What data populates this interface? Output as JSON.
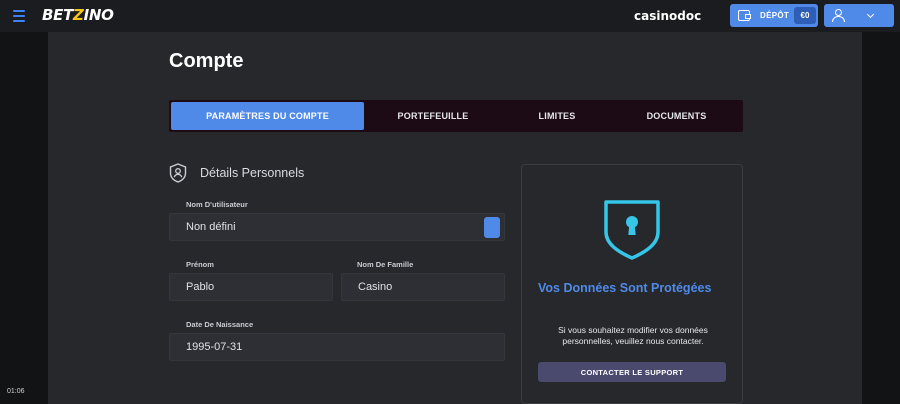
{
  "header": {
    "logo_main": "BET",
    "logo_z": "Z",
    "logo_end": "INO",
    "partner": "casinodoc",
    "deposit_label": "DÉPÔT",
    "balance": "€0"
  },
  "clock": "01:06",
  "page": {
    "title": "Compte"
  },
  "tabs": [
    {
      "label": "PARAMÈTRES DU COMPTE",
      "active": true
    },
    {
      "label": "PORTEFEUILLE",
      "active": false
    },
    {
      "label": "LIMITES",
      "active": false
    },
    {
      "label": "DOCUMENTS",
      "active": false
    }
  ],
  "personal": {
    "section_title": "Détails Personnels",
    "username": {
      "label": "Nom D'utilisateur",
      "value": "Non défini"
    },
    "first_name": {
      "label": "Prénom",
      "value": "Pablo"
    },
    "last_name": {
      "label": "Nom De Famille",
      "value": "Casino"
    },
    "birth_date": {
      "label": "Date De Naissance",
      "value": "1995-07-31"
    }
  },
  "protection": {
    "title": "Vos Données Sont Protégées",
    "text": "Si vous souhaitez modifier vos données personnelles, veuillez nous contacter.",
    "button": "CONTACTER LE SUPPORT"
  },
  "colors": {
    "accent": "#4f8ae8",
    "shield": "#35c6e8",
    "tabs_bg": "#1c0a14",
    "panel_bg": "#26282c",
    "page_bg": "#121315"
  },
  "icons": {
    "menu": "hamburger-icon",
    "wallet": "wallet-icon",
    "user": "user-icon",
    "chevron": "chevron-down-icon",
    "section": "shield-user-icon",
    "protection": "shield-keyhole-icon"
  }
}
